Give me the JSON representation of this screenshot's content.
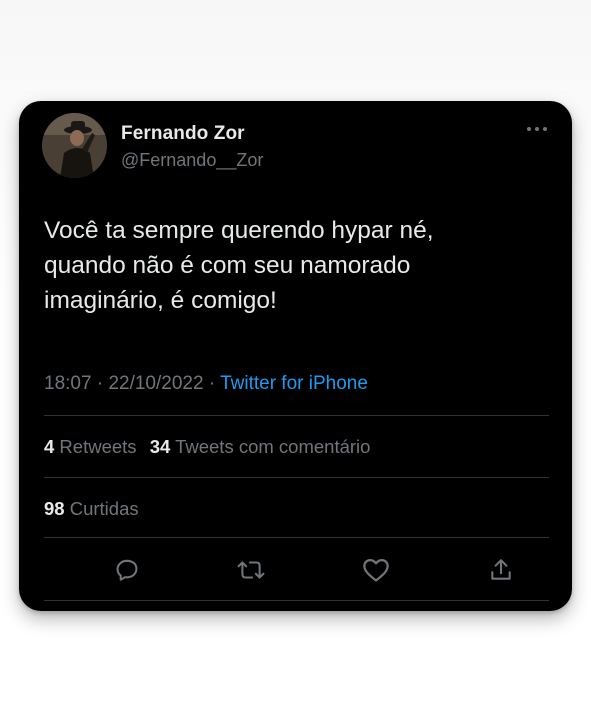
{
  "user": {
    "display_name": "Fernando Zor",
    "handle": "@Fernando__Zor"
  },
  "tweet": {
    "text": "Você ta sempre querendo hypar né,\nquando não é com seu namorado\nimaginário, é comigo!",
    "time": "18:07",
    "date": "22/10/2022",
    "separator": " · ",
    "source": "Twitter for iPhone"
  },
  "stats": {
    "retweets_count": "4",
    "retweets_label": " Retweets",
    "quotes_count": "34",
    "quotes_label": " Tweets com comentário",
    "likes_count": "98",
    "likes_label": " Curtidas"
  },
  "icons": {
    "more": "more-icon",
    "reply": "reply-icon",
    "retweet": "retweet-icon",
    "like": "heart-icon",
    "share": "share-icon"
  },
  "colors": {
    "background": "#000000",
    "text": "#e7e9ea",
    "secondary": "#71767b",
    "link": "#1d9bf0",
    "divider": "#2f3336"
  }
}
